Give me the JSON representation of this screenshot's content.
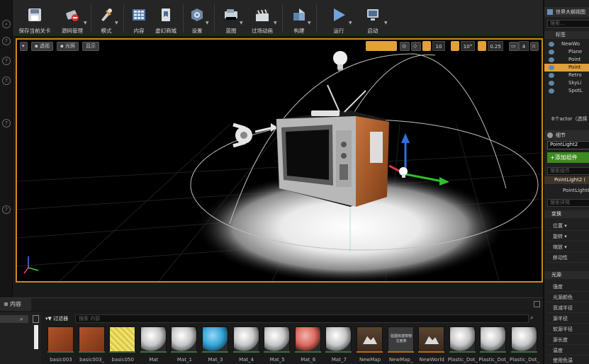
{
  "toolbar": {
    "buttons": [
      {
        "label": "保存当前关卡"
      },
      {
        "label": "源码管理"
      },
      {
        "label": "模式"
      },
      {
        "label": "内容"
      },
      {
        "label": "虚幻商城"
      },
      {
        "label": "设置"
      },
      {
        "label": "蓝图"
      },
      {
        "label": "过场动画"
      },
      {
        "label": "构建"
      },
      {
        "label": "运行"
      },
      {
        "label": "启动"
      }
    ]
  },
  "viewport": {
    "view_mode_label": "透视",
    "lighting_label": "光照",
    "show_label": "显示",
    "grid_snap_value": "10",
    "rotation_snap_value": "10°",
    "scale_snap_value": "0.25",
    "camera_speed_value": "4"
  },
  "world_outliner": {
    "title": "世界大纲视图",
    "search_placeholder": "搜索...",
    "column_label": "标签",
    "items": [
      {
        "label": "NewWo"
      },
      {
        "label": "Plane"
      },
      {
        "label": "Point"
      },
      {
        "label": "Point"
      },
      {
        "label": "Retro"
      },
      {
        "label": "SkyLi"
      },
      {
        "label": "SpotL"
      }
    ],
    "actor_count_text": "6个actor（选择"
  },
  "details": {
    "title": "细节",
    "object_name": "PointLight2",
    "add_component_label": "添加组件",
    "component_search_placeholder": "搜索组件",
    "component_root": "PointLight2 (",
    "component_child": "PointLightC",
    "details_search_placeholder": "搜索详情",
    "transform_section": "变换",
    "transform_props": [
      "位置",
      "旋转",
      "缩放",
      "移动性"
    ],
    "light_section": "光源",
    "light_props": [
      "强度",
      "光源颜色",
      "衰减半径",
      "源半径",
      "软源半径",
      "源长度",
      "温度",
      "使用色温"
    ]
  },
  "content_browser": {
    "tab_label": "内容",
    "filter_label": "过滤器",
    "search_placeholder": "搜索 内容",
    "assets": [
      {
        "name": "basic003",
        "kind": "wood",
        "bar_color": "#3c6e3c"
      },
      {
        "name": "basic003_",
        "kind": "wood",
        "bar_color": "#3c6e3c"
      },
      {
        "name": "basic050",
        "kind": "yellow",
        "bar_color": "#3c6e3c"
      },
      {
        "name": "Mat",
        "kind": "white",
        "bar_color": "#3c6e3c"
      },
      {
        "name": "Mat_1",
        "kind": "white",
        "bar_color": "#3c6e3c"
      },
      {
        "name": "Mat_3",
        "kind": "blue",
        "bar_color": "#3c6e3c"
      },
      {
        "name": "Mat_4",
        "kind": "white",
        "bar_color": "#3c6e3c"
      },
      {
        "name": "Mat_5",
        "kind": "white",
        "bar_color": "#3c6e3c"
      },
      {
        "name": "Mat_6",
        "kind": "red",
        "bar_color": "#3c6e3c"
      },
      {
        "name": "Mat_7",
        "kind": "white",
        "bar_color": "#3c6e3c"
      },
      {
        "name": "NewMap",
        "kind": "map",
        "bar_color": "#b06a1e"
      },
      {
        "name": "NewMap_",
        "kind": "registry",
        "bar_color": "#b06a1e",
        "thumb_text": "贴图有建筑物注册表"
      },
      {
        "name": "NewWorld",
        "kind": "map",
        "bar_color": "#b06a1e"
      },
      {
        "name": "Plastic_Dot_",
        "kind": "white",
        "bar_color": "#3c6e3c"
      },
      {
        "name": "Plastic_Dot_",
        "kind": "white",
        "bar_color": "#3c6e3c"
      },
      {
        "name": "Plastic_Dot_",
        "kind": "white",
        "bar_color": "#3c6e3c"
      }
    ]
  },
  "colors": {
    "accent_orange": "#e3a03a",
    "selection": "#c98a1a",
    "add_component_green": "#3d8a1e"
  }
}
